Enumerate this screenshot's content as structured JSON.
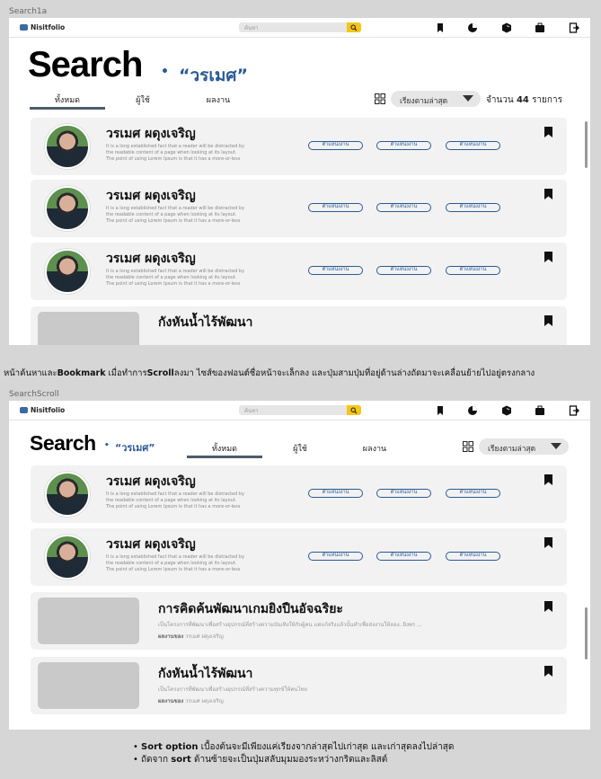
{
  "frame1": {
    "label": "Search1a",
    "query": "“วรเมศ”",
    "count_prefix": "จำนวน",
    "count_value": "44",
    "count_suffix": "รายการ"
  },
  "frame2": {
    "label": "SearchScroll",
    "query": "“วรเมศ”"
  },
  "navbar": {
    "logo": "Nisitfolio",
    "search_placeholder": "ค้นหา",
    "icons": [
      "bookmark-icon",
      "chart-icon",
      "cube-icon",
      "briefcase-icon",
      "logout-icon"
    ]
  },
  "page_title": "Search",
  "tabs": [
    "ทั้งหมด",
    "ผู้ใช้",
    "ผลงาน"
  ],
  "sort": {
    "label": "เรียงตามล่าสุด"
  },
  "person": {
    "name": "วรเมศ ผดุงเจริญ",
    "desc1": "It is a long established fact that a reader will be distracted by",
    "desc2": "the readable content of a page when looking at its layout.",
    "desc3": "The point of using Lorem Ipsum is that it has a more-or-less",
    "tag": "ตำแหน่งงาน"
  },
  "works": [
    {
      "title": "การคิดค้นพัฒนาเกมยิงปืนอัจฉริยะ",
      "desc": "เป็นโครงการที่พัฒนาเพื่อสร้างอุปกรณ์ที่สร้างความบันเทิงให้กับผู้คน แต่แก้จริงแล้วนั้นทำเพื่อส่งงานให้ลอง..ยิงพร ...",
      "owner_label": "ผลงานของ",
      "owner_name": "วรเมศ ผดุงเจริญ"
    },
    {
      "title": "กังหันน้ำไร้พัฒนา",
      "desc": "เป็นโครงการที่พัฒนาเพื่อสร้างอุปกรณ์ที่สร้างความทุกข์ให้คนไทย",
      "owner_label": "ผลงานของ",
      "owner_name": "วรเมศ ผดุงเจริญ"
    }
  ],
  "caption": {
    "part1": "หน้าค้นหาและ",
    "bold1": "Bookmark",
    "part2": " เมื่อทำการ",
    "bold2": "Scroll",
    "part3": "ลงมา ไซส์ของฟอนต์ชื่อหน้าจะเล็กลง และปุ่มสามปุ่มที่อยู่ด้านล่างถัดมาจะเคลื่อนย้ายไปอยู่ตรงกลาง"
  },
  "notes": [
    {
      "bold": "Sort option",
      "text": " เบื้องต้นจะมีเพียงแค่เรียงจากล่าสุดไปเก่าสุด และเก่าสุดลงไปล่าสุด"
    },
    {
      "pre": "ถัดจาก ",
      "bold": "sort",
      "text": " ด้านซ้ายจะเป็นปุ่มสลับมุมมองระหว่างกริดและลิสต์"
    }
  ],
  "colors": {
    "accent": "#2a5a95",
    "search_button": "#f5c518",
    "card_bg": "#f2f2f2",
    "tab_underline": "#4c5c6c"
  }
}
